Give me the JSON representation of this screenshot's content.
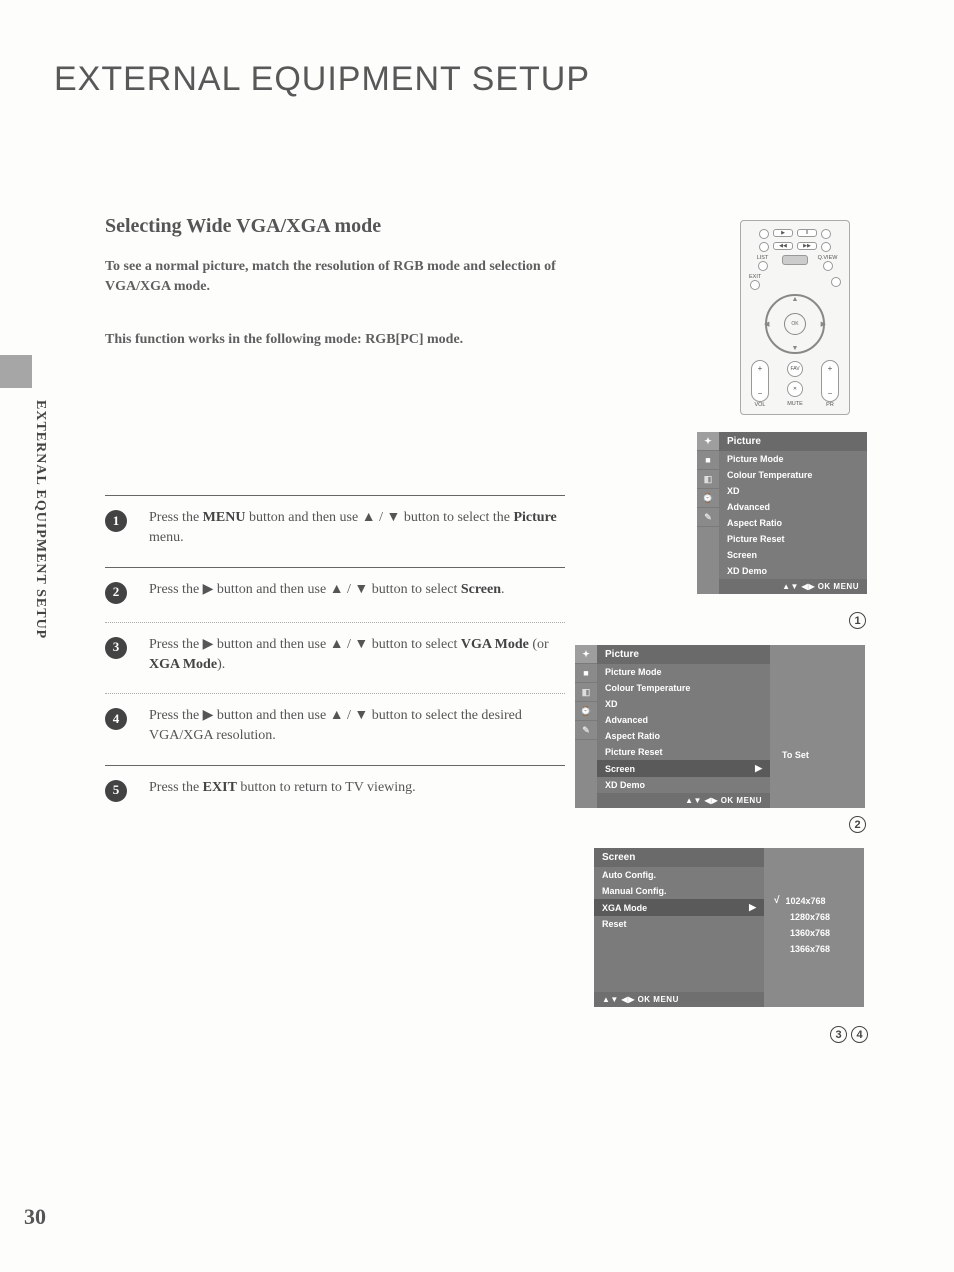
{
  "page": {
    "title": "EXTERNAL EQUIPMENT SETUP",
    "side_label": "EXTERNAL EQUIPMENT SETUP",
    "section_title": "Selecting Wide VGA/XGA mode",
    "intro1": "To see a normal picture, match the resolution of RGB mode and selection of VGA/XGA mode.",
    "intro2": "This function works in the following mode: RGB[PC] mode.",
    "page_number": "30"
  },
  "steps": [
    {
      "num": "1",
      "pre": "Press the ",
      "b1": "MENU",
      "mid": " button and then use ▲ / ▼ button to select the ",
      "b2": "Picture",
      "post": " menu."
    },
    {
      "num": "2",
      "pre": "Press the ▶ button and then use ▲ / ▼ button to select ",
      "b1": "Screen",
      "mid": ".",
      "b2": "",
      "post": ""
    },
    {
      "num": "3",
      "pre": "Press the ▶ button and then use ▲ / ▼ button to select ",
      "b1": "VGA Mode",
      "mid": " (or ",
      "b2": "XGA Mode",
      "post": ")."
    },
    {
      "num": "4",
      "pre": "Press the ▶ button and then use ▲ / ▼ button to select the desired VGA/XGA resolution.",
      "b1": "",
      "mid": "",
      "b2": "",
      "post": ""
    },
    {
      "num": "5",
      "pre": "Press the ",
      "b1": "EXIT",
      "mid": " button to return to TV viewing.",
      "b2": "",
      "post": ""
    }
  ],
  "remote": {
    "labels": {
      "list": "LIST",
      "qview": "Q.VIEW",
      "exit": "EXIT",
      "ok": "OK",
      "vol": "VOL",
      "pr": "PR",
      "fav": "FAV",
      "mute": "MUTE"
    }
  },
  "osd1": {
    "title": "Picture",
    "items": [
      "Picture Mode",
      "Colour Temperature",
      "XD",
      "Advanced",
      "Aspect Ratio",
      "Picture Reset",
      "Screen",
      "XD Demo"
    ],
    "footer": "▲▼  ◀▶  OK  MENU"
  },
  "osd2": {
    "title": "Picture",
    "items": [
      "Picture Mode",
      "Colour Temperature",
      "XD",
      "Advanced",
      "Aspect Ratio",
      "Picture Reset",
      "Screen",
      "XD Demo"
    ],
    "selected": "Screen",
    "side_label": "To Set",
    "footer": "▲▼  ◀▶  OK  MENU"
  },
  "osd3": {
    "title": "Screen",
    "items": [
      "Auto Config.",
      "Manual Config.",
      "XGA Mode",
      "Reset"
    ],
    "selected": "XGA Mode",
    "resolutions": [
      "1024x768",
      "1280x768",
      "1360x768",
      "1366x768"
    ],
    "checked": "1024x768",
    "footer": "▲▼  ◀▶  OK  MENU"
  },
  "callouts": {
    "c1": "1",
    "c2": "2",
    "c3": "3",
    "c4": "4"
  }
}
